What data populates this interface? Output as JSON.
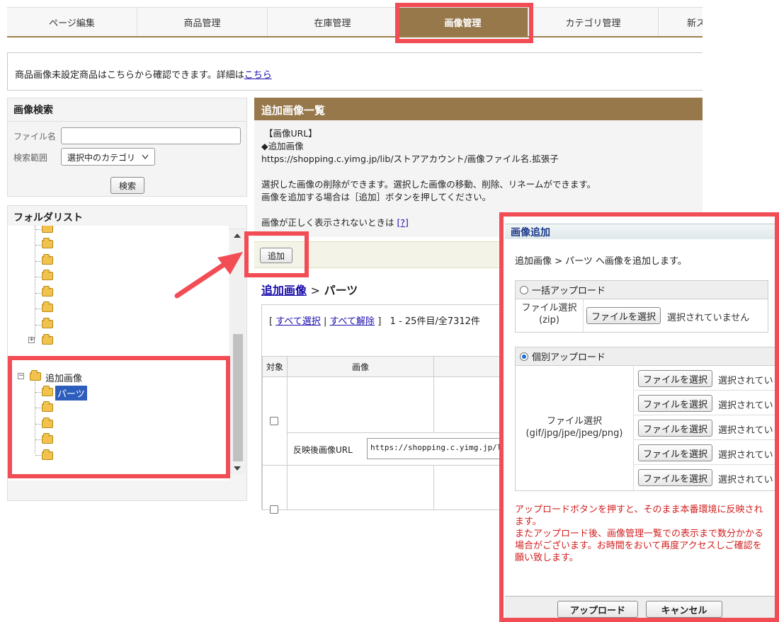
{
  "tabs": [
    {
      "label": "ページ編集"
    },
    {
      "label": "商品管理"
    },
    {
      "label": "在庫管理"
    },
    {
      "label": "画像管理"
    },
    {
      "label": "カテゴリ管理"
    },
    {
      "label": "新ス"
    }
  ],
  "notice": {
    "text": "商品画像未設定商品はこちらから確認できます。詳細は",
    "link": "こちら"
  },
  "search": {
    "title": "画像検索",
    "file_label": "ファイル名",
    "file_value": "",
    "scope_label": "検索範囲",
    "scope_value": "選択中のカテゴリ",
    "button": "検索"
  },
  "folders": {
    "title": "フォルダリスト",
    "root_label": "追加画像",
    "selected_label": "パーツ",
    "plus": "+",
    "minus": "−"
  },
  "main": {
    "title": "追加画像一覧",
    "url_heading": "【画像URL】",
    "url_sub": "◆追加画像",
    "url_pattern": "https://shopping.c.yimg.jp/lib/ストアアカウント/画像ファイル名.拡張子",
    "info1": "選択した画像の削除ができます。選択した画像の移動、削除、リネームができます。",
    "info2": "画像を追加する場合は［追加］ボタンを押してください。",
    "help_text": "画像が正しく表示されないときは",
    "help_link": "[?]",
    "add_button": "追加",
    "breadcrumb_link": "追加画像",
    "breadcrumb_sep": ">",
    "breadcrumb_current": "パーツ",
    "bracket_open": "[",
    "select_all": "すべて選択",
    "pipe": "|",
    "deselect_all": "すべて解除",
    "bracket_close": "]",
    "count": "1 - 25件目/全7312件",
    "col_target": "対象",
    "col_image": "画像",
    "url_label": "反映後画像URL",
    "url_value": "https://shopping.c.yimg.jp/lib/"
  },
  "modal": {
    "title": "画像追加",
    "desc": "追加画像 > パーツ へ画像を追加します。",
    "bulk_label": "一括アップロード",
    "bulk_file_label": "ファイル選択\n(zip)",
    "individual_label": "個別アップロード",
    "individual_file_label": "ファイル選択\n(gif/jpg/jpe/jpeg/png)",
    "file_button": "ファイルを選択",
    "not_selected": "選択されていません",
    "not_selected_short": "選択されてい",
    "warning": "アップロードボタンを押すと、そのまま本番環境に反映されます。\nまたアップロード後、画像管理一覧での表示まで数分かかる場合がございます。お時間をおいて再度アクセスしご確認を願い致します。",
    "upload_button": "アップロード",
    "cancel_button": "キャンセル"
  },
  "colors": {
    "accent": "#96784b",
    "highlight": "#f24d55",
    "link": "#1a0dab",
    "warning": "#d11d1d"
  }
}
